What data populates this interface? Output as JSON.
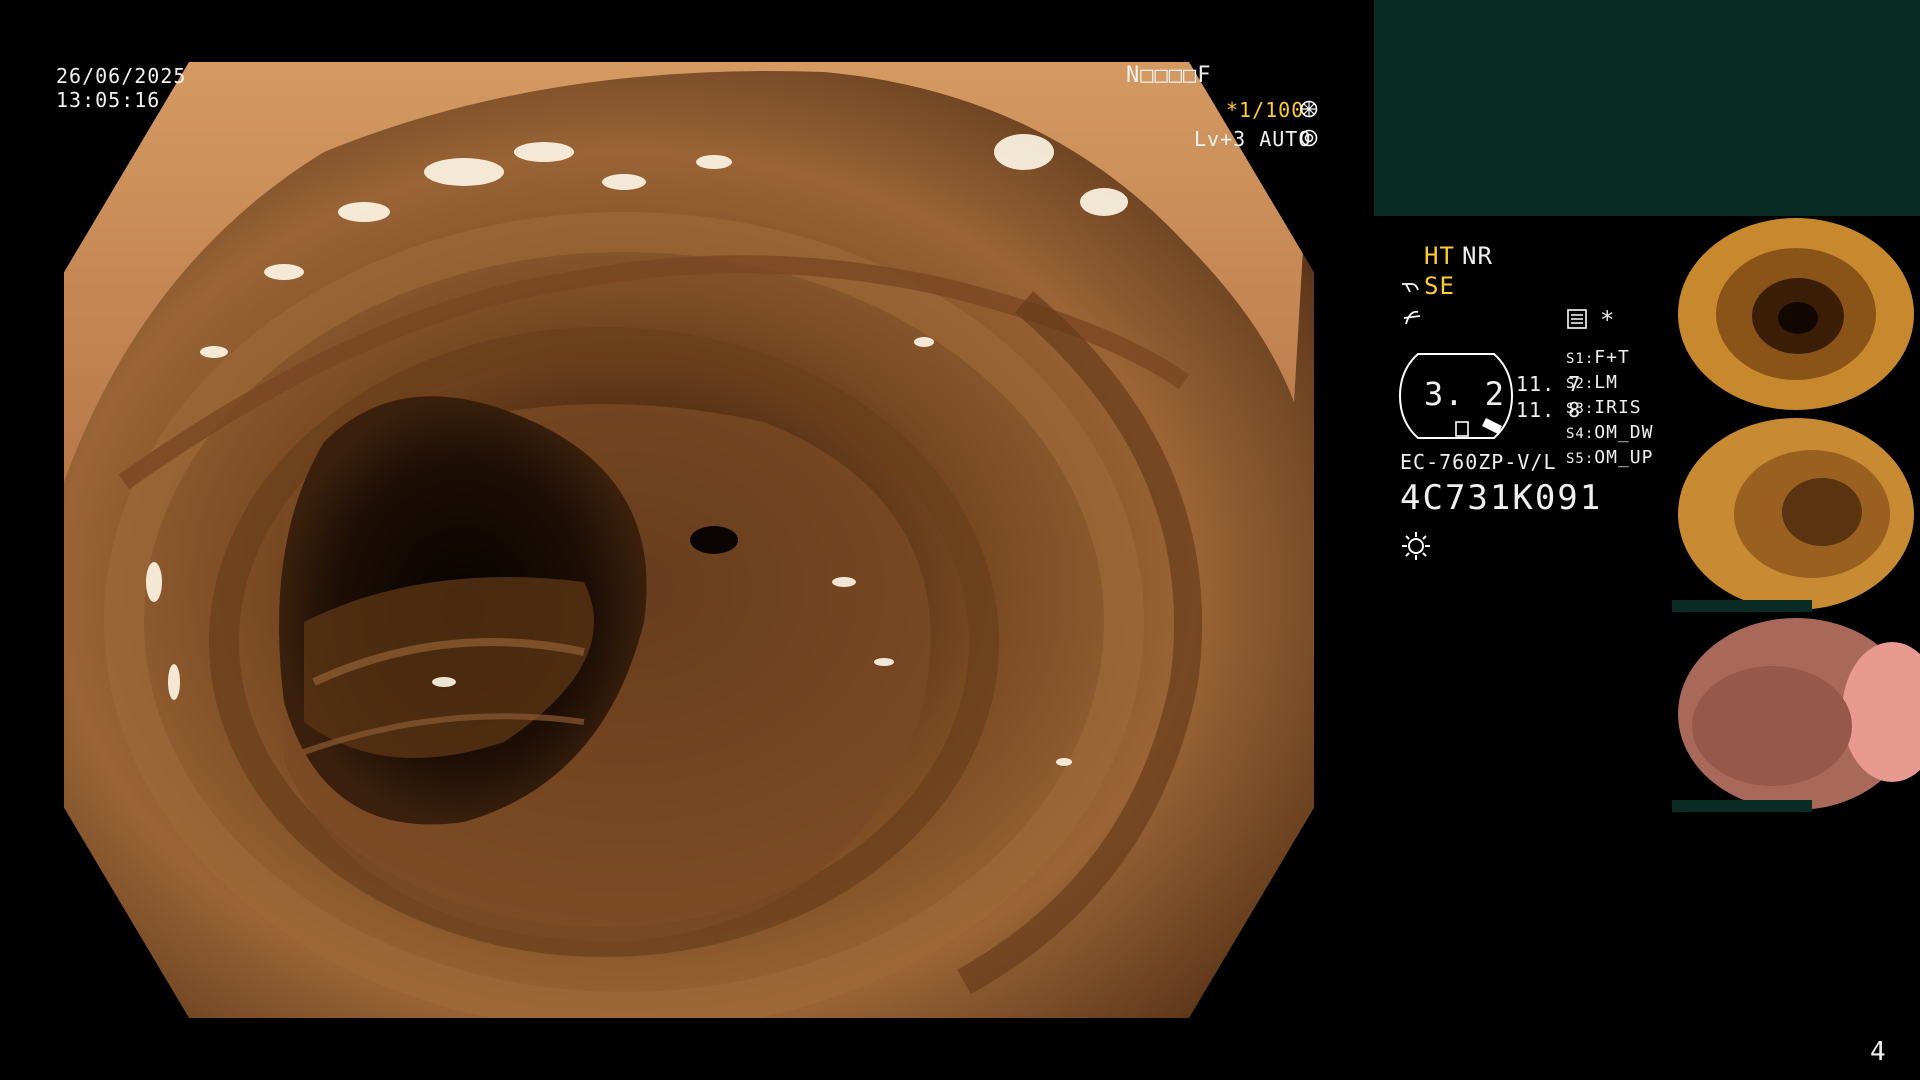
{
  "overlay": {
    "date": "26/06/2025",
    "time": "13:05:16",
    "patient_code": "N□□□□F",
    "shutter": "*1/100",
    "level": "Lv+3 AUTO"
  },
  "settings": {
    "ht": "HT",
    "nr": "NR",
    "se": "SE",
    "zoom_value": "3. 2",
    "reading_1": "11. 7",
    "reading_2": "11. 8",
    "scope_model": "EC-760ZP-V/L",
    "serial": "4C731K091",
    "star": "*",
    "switches": [
      {
        "key": "S1:",
        "value": "F+T"
      },
      {
        "key": "S2:",
        "value": "LM"
      },
      {
        "key": "S3:",
        "value": "IRIS"
      },
      {
        "key": "S4:",
        "value": "OM_DW"
      },
      {
        "key": "S5:",
        "value": "OM_UP"
      }
    ]
  },
  "page_number": "4",
  "colors": {
    "accent": "#ffcc33",
    "thumb_panel": "#0a2a24",
    "tissue_dark": "#3a1e0c",
    "tissue_mid": "#8a5a2a",
    "tissue_light": "#d69a5a"
  },
  "icons": [
    "shutter-icon",
    "iris-icon",
    "scope-icon",
    "freeze-icon",
    "memory-icon",
    "light-icon"
  ]
}
